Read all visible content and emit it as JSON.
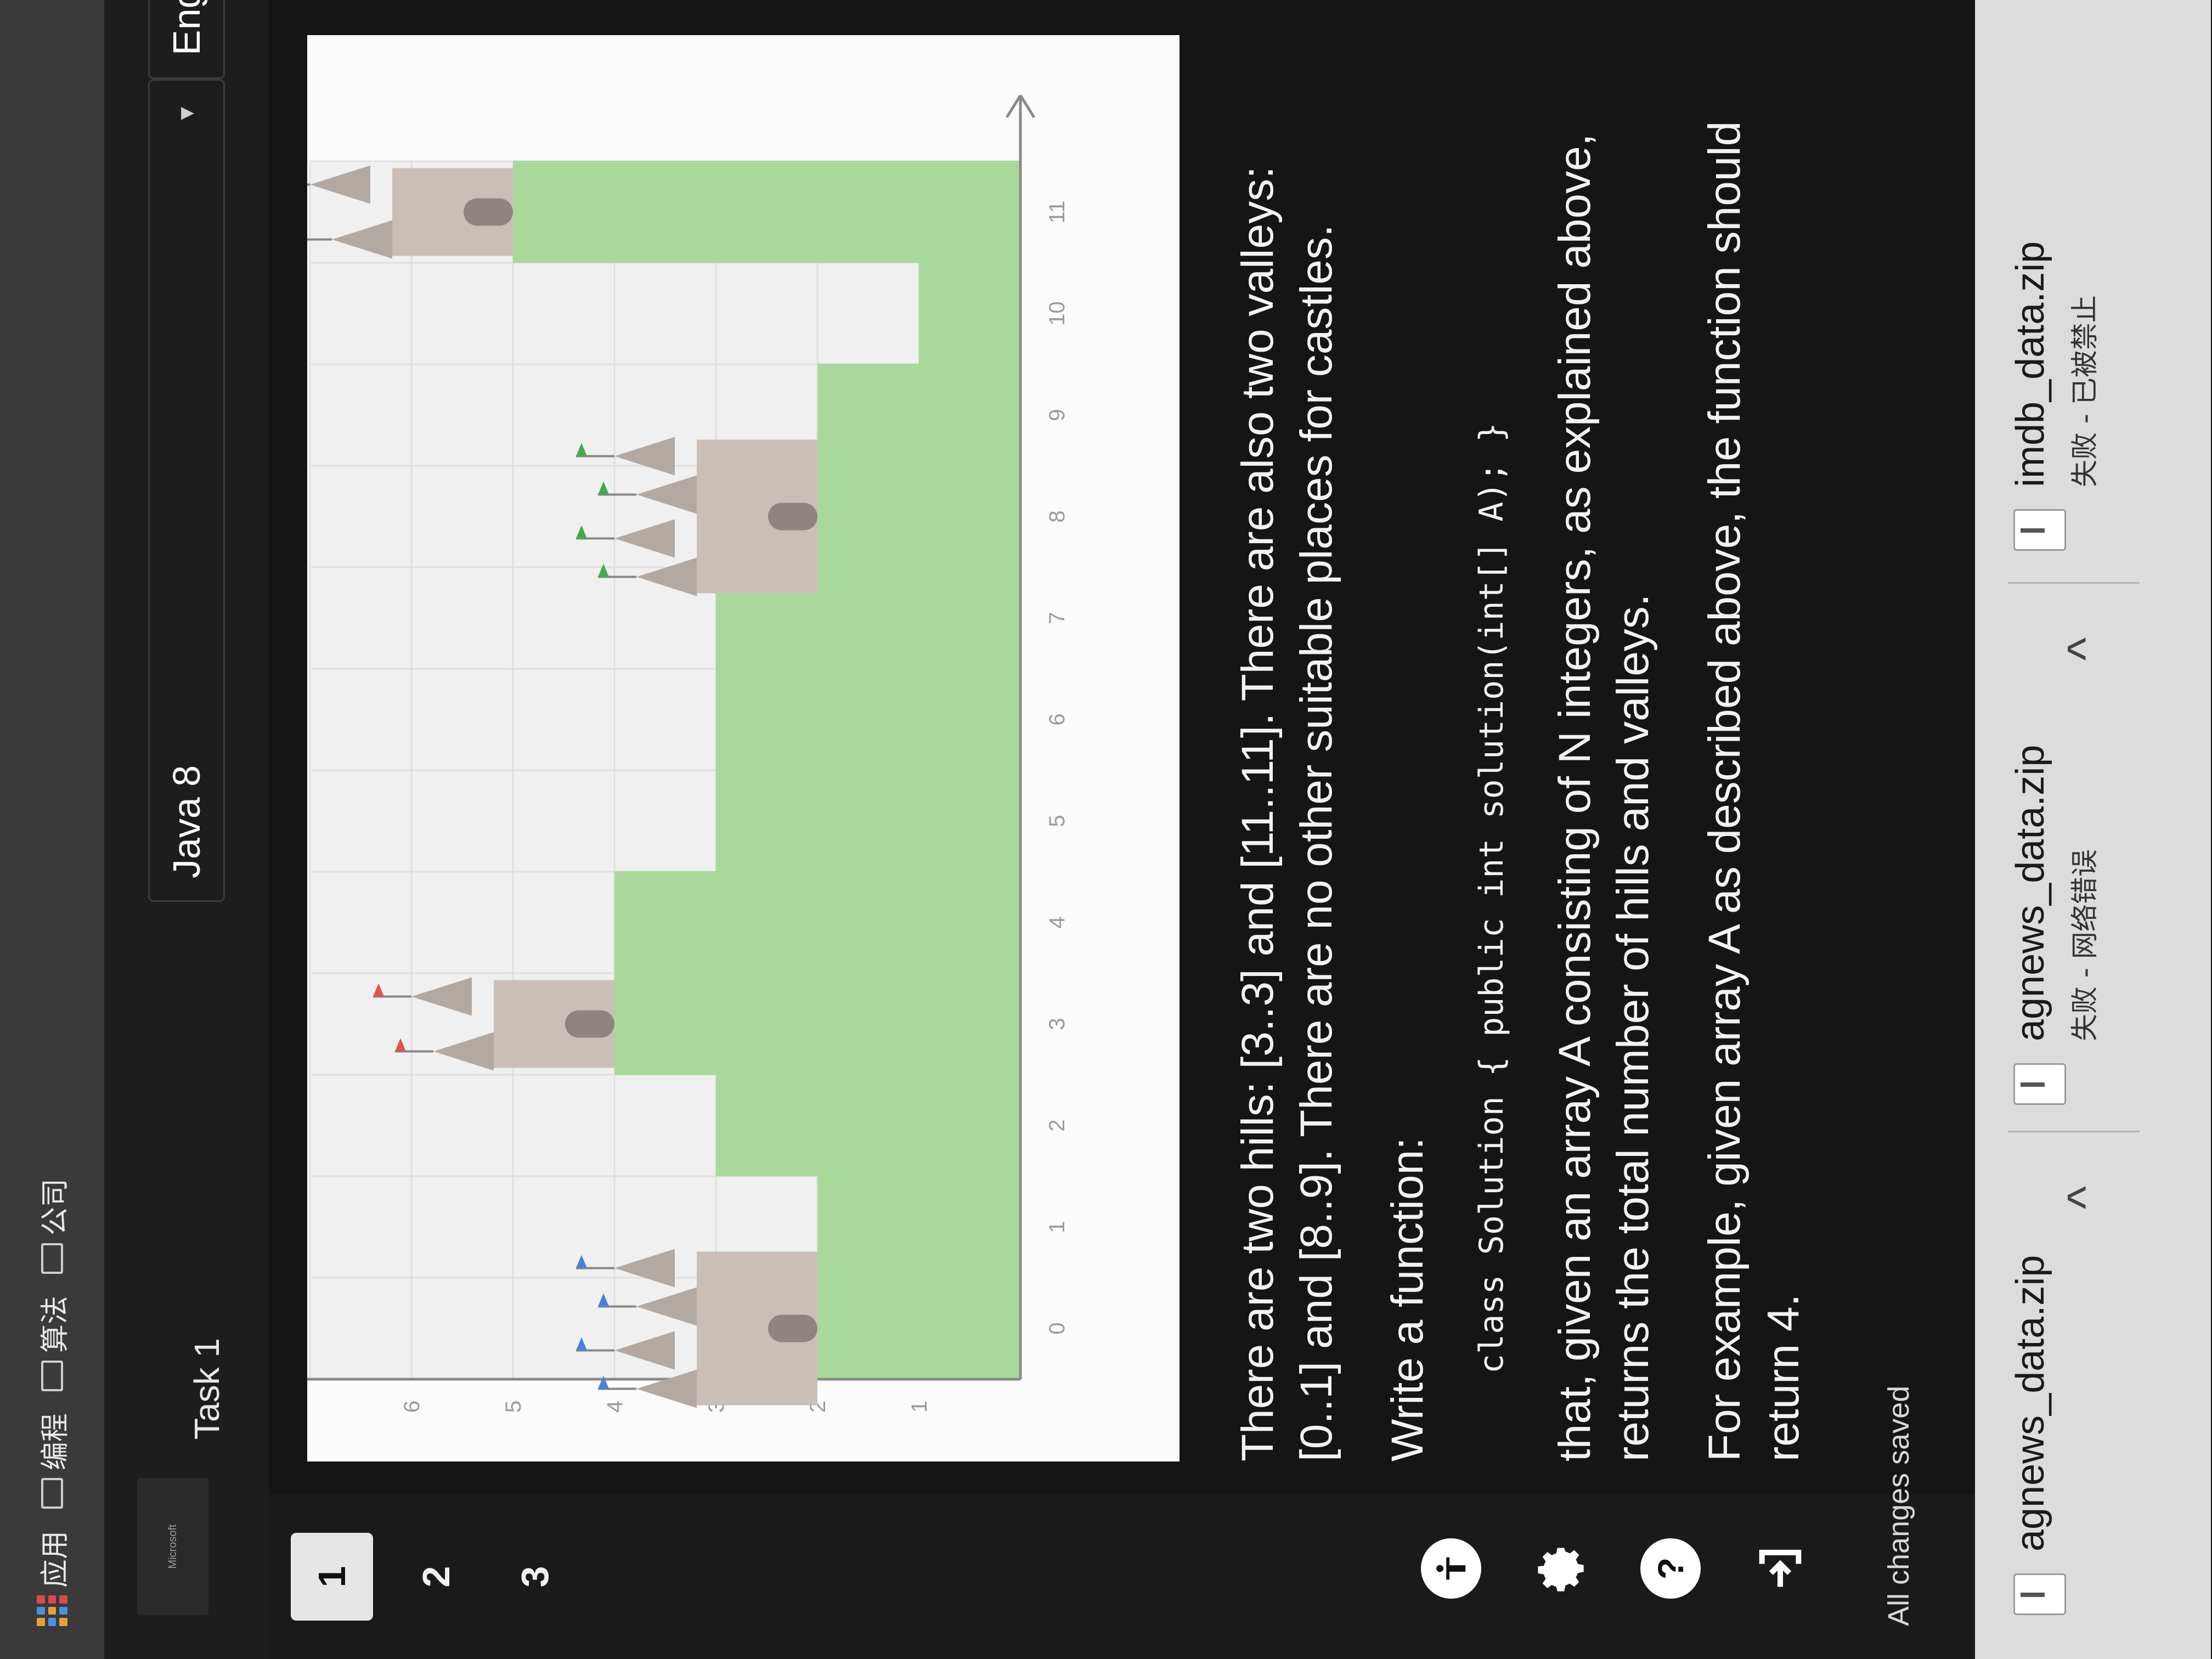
{
  "bookmarks": [
    {
      "label": "应用",
      "icon": "apps-grid-icon"
    },
    {
      "label": "编程",
      "icon": "folder-icon"
    },
    {
      "label": "算法",
      "icon": "folder-icon"
    },
    {
      "label": "公司",
      "icon": "folder-icon"
    }
  ],
  "header": {
    "logo_text": "Microsoft",
    "task_tab": "Task 1",
    "language_select": "Java 8",
    "locale_select": "English"
  },
  "rail": {
    "tasks": [
      "1",
      "2",
      "3"
    ],
    "icons": [
      "accessibility-icon",
      "gear-icon",
      "help-icon",
      "exit-icon"
    ],
    "help_glyph": "?"
  },
  "chart_data": {
    "type": "area",
    "x": [
      0,
      1,
      2,
      3,
      4,
      5,
      6,
      7,
      8,
      9,
      10,
      11
    ],
    "heights": [
      2,
      2,
      3,
      4,
      4,
      3,
      3,
      3,
      2,
      2,
      1,
      5
    ],
    "yticks": [
      1,
      2,
      3,
      4,
      5,
      6
    ],
    "xticks": [
      0,
      1,
      2,
      3,
      4,
      5,
      6,
      7,
      8,
      9,
      10,
      11
    ],
    "castles": [
      {
        "x": 0.5,
        "color": "#4a7fe0",
        "kind": "valley"
      },
      {
        "x": 3,
        "color": "#e0544a",
        "kind": "hill"
      },
      {
        "x": 8.5,
        "color": "#3fae4a",
        "kind": "valley"
      },
      {
        "x": 11,
        "color": "#e89a3a",
        "kind": "hill"
      }
    ],
    "colors": {
      "ground": "#a8d99b",
      "sky": "#f0f0f0",
      "castle": "#c9bfb8",
      "axis": "#8a8a8a"
    }
  },
  "description": {
    "para1": "There are two hills: [3..3] and [11..11]. There are also two valleys: [0..1] and [8..9]. There are no other suitable places for castles.",
    "para2": "Write a function:",
    "code": "class Solution { public int solution(int[] A); }",
    "para3": "that, given an array A consisting of N integers, as explained above, returns the total number of hills and valleys.",
    "para4": "For example, given array A as described above, the function should return 4."
  },
  "status": "All changes saved",
  "downloads": [
    {
      "name": "agnews_data.zip",
      "status": ""
    },
    {
      "name": "agnews_data.zip",
      "status": "失败 - 网络错误"
    },
    {
      "name": "imdb_data.zip",
      "status": "失败 - 已被禁止"
    }
  ]
}
